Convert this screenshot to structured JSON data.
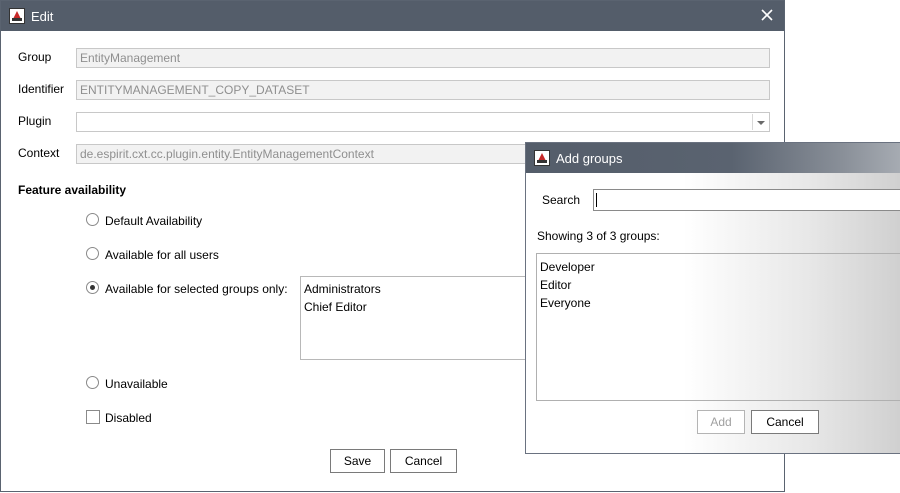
{
  "edit_dialog": {
    "title": "Edit",
    "icons": {
      "app": "app-logo-icon",
      "close": "close-icon"
    },
    "fields": {
      "group": {
        "label": "Group",
        "value": "EntityManagement"
      },
      "identifier": {
        "label": "Identifier",
        "value": "ENTITYMANAGEMENT_COPY_DATASET"
      },
      "plugin": {
        "label": "Plugin",
        "value": ""
      },
      "context": {
        "label": "Context",
        "value": "de.espirit.cxt.cc.plugin.entity.EntityManagementContext"
      }
    },
    "feature_availability": {
      "title": "Feature availability",
      "options": [
        {
          "label": "Default Availability",
          "checked": false
        },
        {
          "label": "Available for all users",
          "checked": false
        },
        {
          "label": "Available for selected groups only:",
          "checked": true
        },
        {
          "label": "Unavailable",
          "checked": false
        }
      ],
      "selected_groups": [
        "Administrators",
        "Chief Editor"
      ],
      "disabled_label": "Disabled",
      "disabled_checked": false
    },
    "buttons": {
      "save": "Save",
      "cancel": "Cancel"
    }
  },
  "add_groups_dialog": {
    "title": "Add groups",
    "search": {
      "label": "Search",
      "value": ""
    },
    "showing": "Showing 3 of 3 groups:",
    "groups": [
      "Developer",
      "Editor",
      "Everyone"
    ],
    "buttons": {
      "add": "Add",
      "cancel": "Cancel"
    }
  },
  "colors": {
    "titlebar": "#545d6a",
    "field_bg": "#f2f2f2",
    "disabled_text": "#8f8f8f"
  }
}
